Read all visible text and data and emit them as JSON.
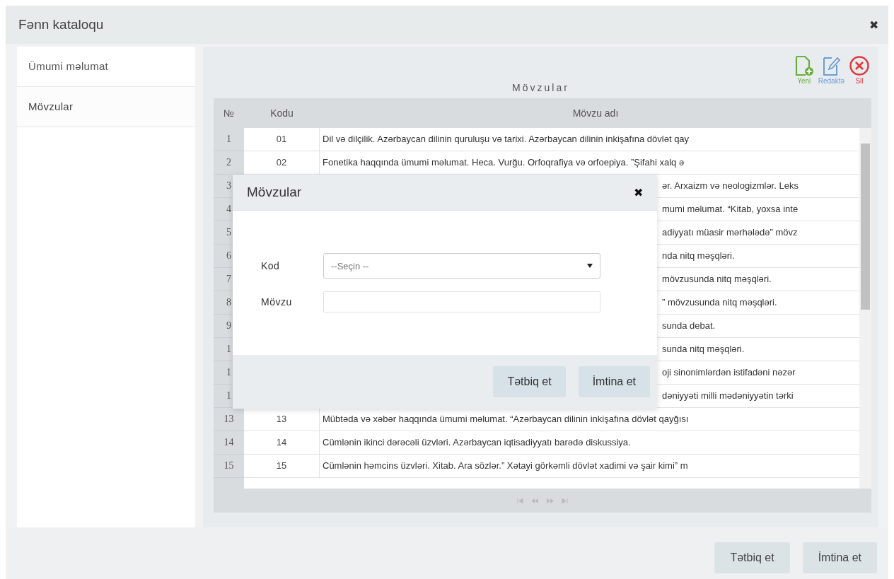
{
  "window": {
    "title": "Fənn kataloqu",
    "close": "✖"
  },
  "sidebar": {
    "items": [
      {
        "label": "Ümumi məlumat",
        "selected": false
      },
      {
        "label": "Mövzular",
        "selected": true
      }
    ]
  },
  "panel": {
    "title": "Mövzular",
    "toolbar": [
      {
        "kind": "new",
        "label": "Yeni",
        "color": "#6aaf3d"
      },
      {
        "kind": "edit",
        "label": "Redaktə",
        "color": "#6a9ed8"
      },
      {
        "kind": "delete",
        "label": "Sil",
        "color": "#e0393e"
      }
    ],
    "table": {
      "columns": [
        "№",
        "Kodu",
        "Mövzu adı"
      ],
      "rows": [
        {
          "num": "1",
          "code": "01",
          "title": "Dil və dilçilik. Azərbaycan dilinin quruluşu və tarixi. Azərbaycan dilinin inkişafına dövlət qay",
          "covered": false
        },
        {
          "num": "2",
          "code": "02",
          "title": "Fonetika haqqında ümumi məlumat. Heca. Vurğu. Orfoqrafiya və orfoepiya. ”Şifahi xalq ə",
          "covered": false
        },
        {
          "num": "3",
          "title": "ər. Arxaizm və neologizmlər. Leks",
          "covered": true
        },
        {
          "num": "4",
          "title": "mumi məlumat. “Kitab, yoxsa inte",
          "covered": true
        },
        {
          "num": "5",
          "title": "adiyyatı müasir mərhələdə” mövz",
          "covered": true
        },
        {
          "num": "6",
          "title": "nda nitq məşqləri.",
          "covered": true
        },
        {
          "num": "7",
          "title": "mövzusunda nitq məşqləri.",
          "covered": true
        },
        {
          "num": "8",
          "title": "” mövzusunda nitq məşqləri.",
          "covered": true
        },
        {
          "num": "9",
          "title": "sunda debat.",
          "covered": true
        },
        {
          "num": "1",
          "title": "sunda nitq məşqləri.",
          "covered": true
        },
        {
          "num": "1",
          "title": "oji sinonimlərdən istifadəni nəzər",
          "covered": true
        },
        {
          "num": "1",
          "title": "dəniyyəti milli mədəniyyətin tərki",
          "covered": true
        },
        {
          "num": "13",
          "code": "13",
          "title": "Mübtəda və xəbər haqqında ümumi məlumat. “Azərbaycan dilinin inkişafına dövlət qayğısı",
          "covered": false
        },
        {
          "num": "14",
          "code": "14",
          "title": "Cümlənin ikinci dərəcəli üzvləri. Azərbaycan iqtisadiyyatı barədə diskussiya.",
          "covered": false
        },
        {
          "num": "15",
          "code": "15",
          "title": "Cümlənin həmcins üzvləri. Xitab. Ara sözlər.” Xətayi görkəmli dövlət xadimi və şair kimi” m",
          "covered": false
        }
      ]
    }
  },
  "modal": {
    "title": "Mövzular",
    "close": "✖",
    "fields": [
      {
        "kind": "select",
        "label": "Kod",
        "value": "--Seçin --"
      },
      {
        "kind": "text",
        "label": "Mövzu"
      }
    ],
    "buttons": [
      "Tətbiq et",
      "İmtina et"
    ]
  },
  "buttons": [
    "Tətbiq et",
    "İmtina et"
  ]
}
